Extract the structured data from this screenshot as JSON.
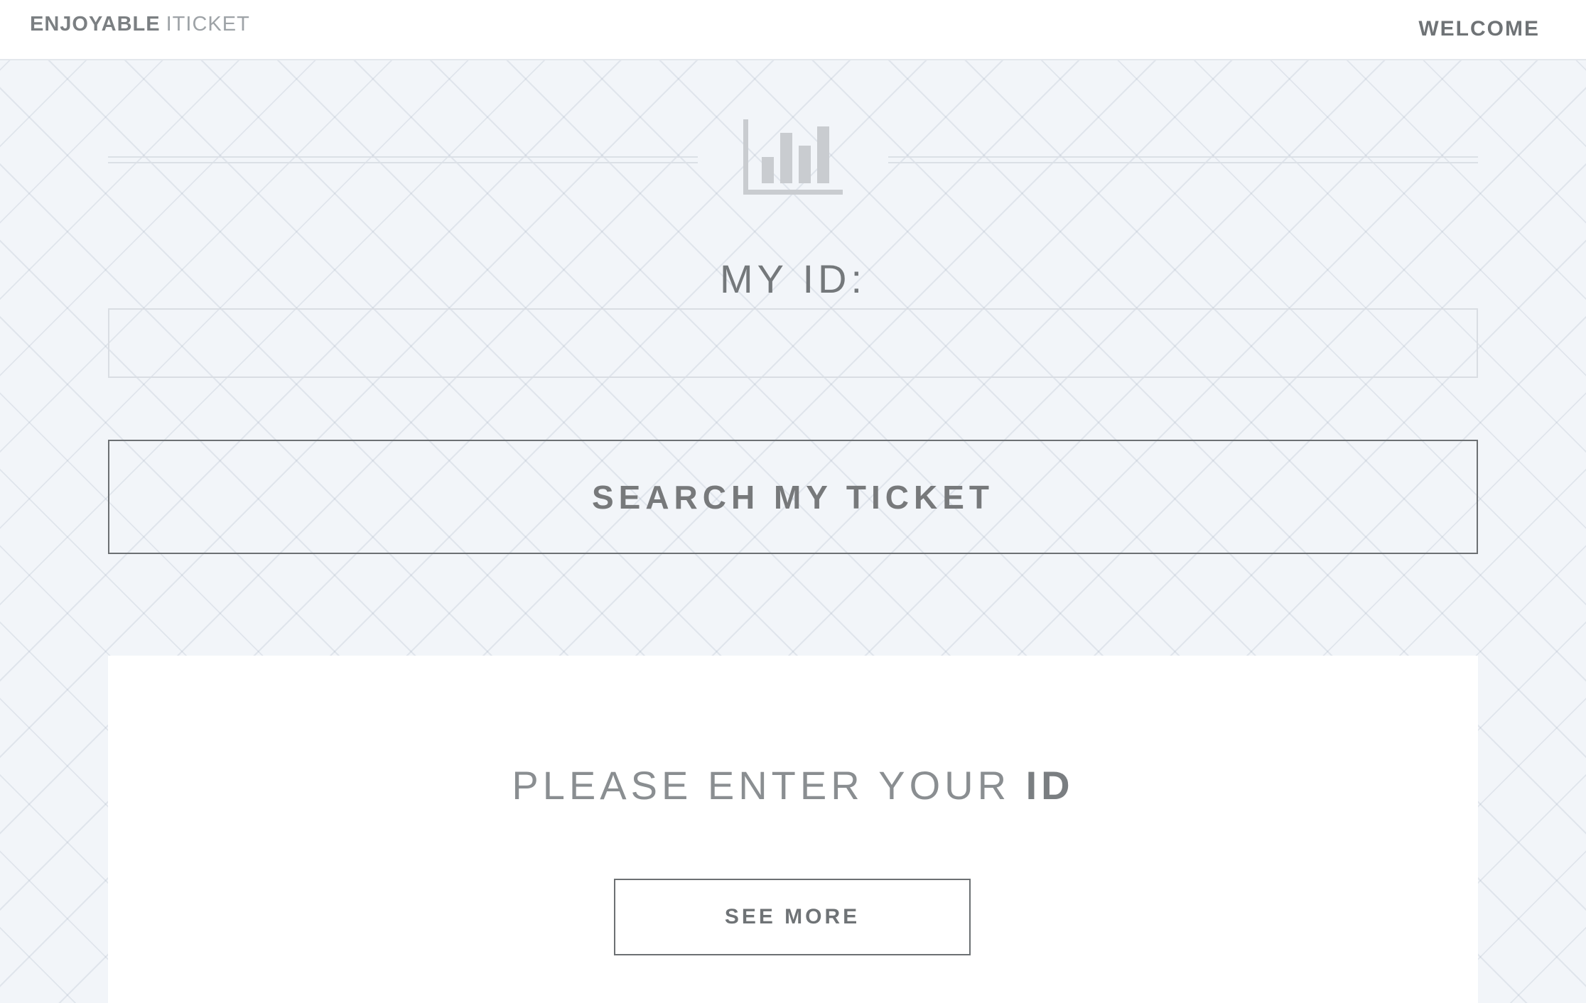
{
  "header": {
    "brand_strong": "ENJOYABLE",
    "brand_light": "ITICKET",
    "welcome_link": "WELCOME"
  },
  "hero": {
    "icon": "bar-chart-icon",
    "id_label": "MY ID:",
    "id_input_value": "",
    "search_button_label": "SEARCH MY TICKET"
  },
  "info_card": {
    "prompt_text": "PLEASE ENTER YOUR ",
    "prompt_emphasis": "ID",
    "see_more_label": "SEE MORE"
  },
  "colors": {
    "background": "#f2f5f9",
    "text_gray": "#74787b",
    "icon_gray": "#c9ccd0",
    "border_dark": "#6c7073"
  }
}
